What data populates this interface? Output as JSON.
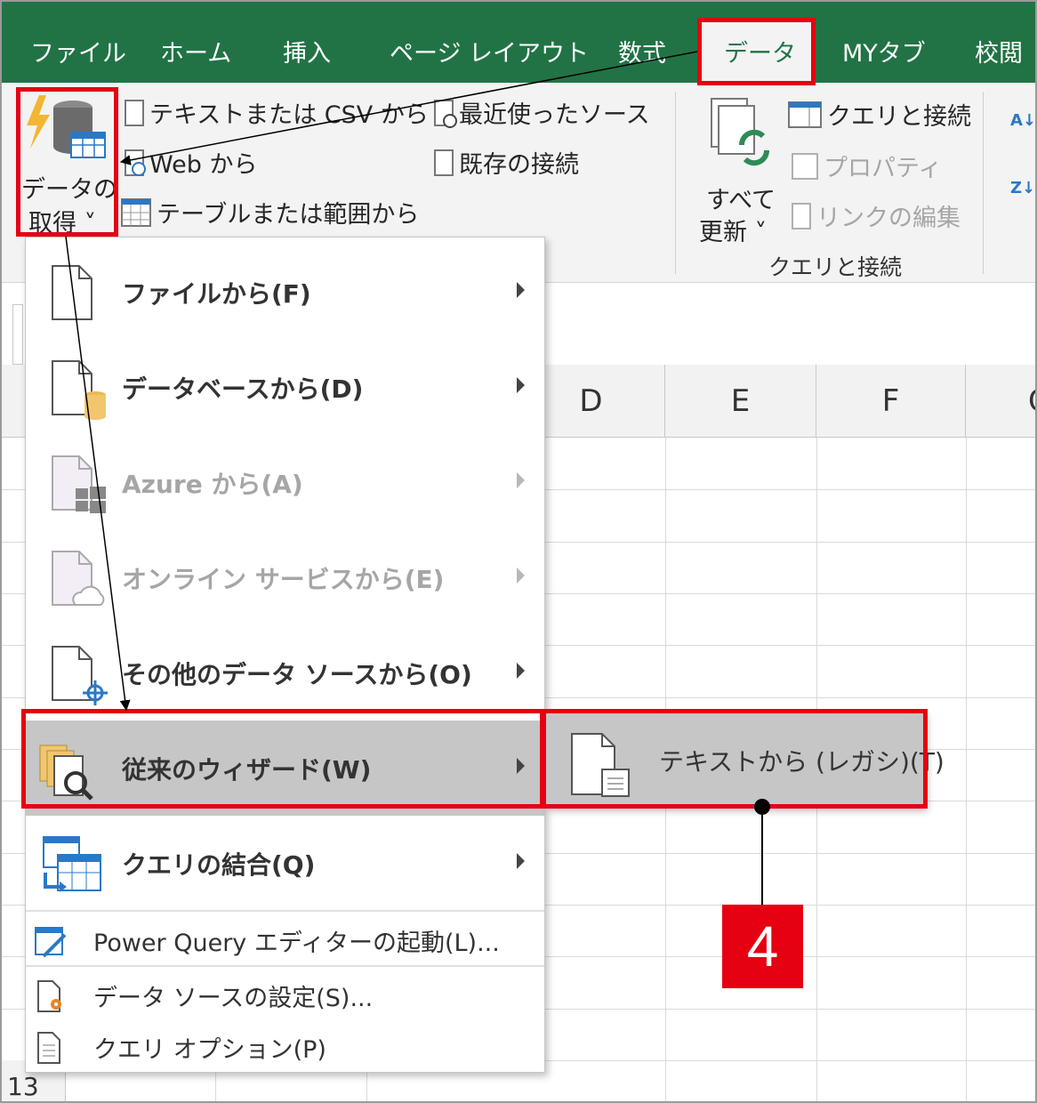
{
  "tabs": [
    "ファイル",
    "ホーム",
    "挿入",
    "ページ レイアウト",
    "数式",
    "データ",
    "MYタブ",
    "校閲"
  ],
  "ribbon": {
    "get_data_line1": "データの",
    "get_data_line2": "取得 ˅",
    "text_csv": "テキストまたは CSV から",
    "web": "Web から",
    "table_range": "テーブルまたは範囲から",
    "recent_sources": "最近使ったソース",
    "existing_conn": "既存の接続",
    "refresh_all_line1": "すべて",
    "refresh_all_line2": "更新 ˅",
    "queries_conn": "クエリと接続",
    "properties": "プロパティ",
    "edit_links": "リンクの編集",
    "group_label": "クエリと接続",
    "sort_az": "A↓Z",
    "sort_za": "Z↓A"
  },
  "columns": [
    "D",
    "E",
    "F",
    "G"
  ],
  "row_number": "13",
  "menu": {
    "items": [
      {
        "label": "ファイルから(F)",
        "disabled": false
      },
      {
        "label": "データベースから(D)",
        "disabled": false
      },
      {
        "label": "Azure から(A)",
        "disabled": true
      },
      {
        "label": "オンライン サービスから(E)",
        "disabled": true
      },
      {
        "label": "その他のデータ ソースから(O)",
        "disabled": false
      },
      {
        "label": "従来のウィザード(W)",
        "disabled": false
      },
      {
        "label": "クエリの結合(Q)",
        "disabled": false
      }
    ],
    "small_items": [
      {
        "label": "Power Query エディターの起動(L)..."
      },
      {
        "label": "データ ソースの設定(S)..."
      },
      {
        "label": "クエリ オプション(P)"
      }
    ]
  },
  "submenu": {
    "label": "テキストから (レガシ)(T)"
  },
  "callout": "4",
  "colors": {
    "excel_green": "#217346",
    "highlight": "#c6c6c6",
    "annotation_red": "#e50012"
  }
}
